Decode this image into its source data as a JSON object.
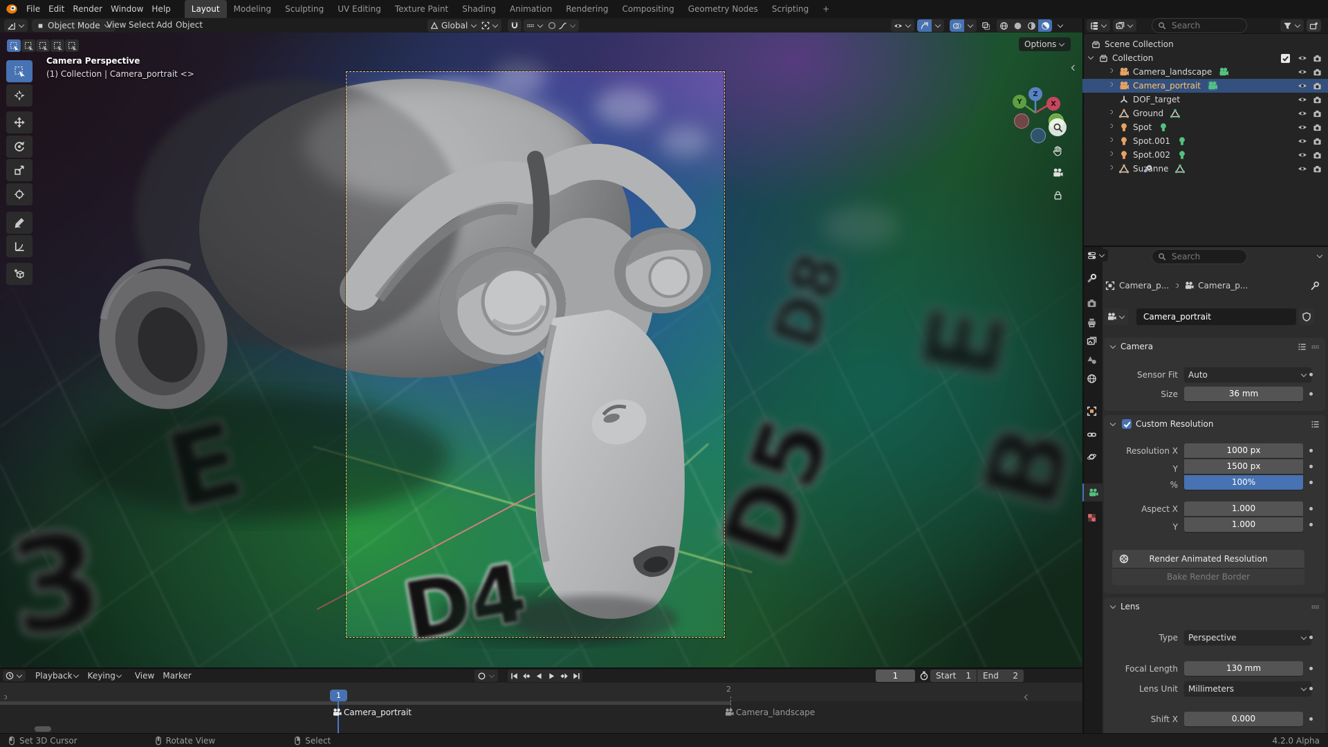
{
  "topbar": {
    "menus": [
      "File",
      "Edit",
      "Render",
      "Window",
      "Help"
    ],
    "workspaces": [
      "Layout",
      "Modeling",
      "Sculpting",
      "UV Editing",
      "Texture Paint",
      "Shading",
      "Animation",
      "Rendering",
      "Compositing",
      "Geometry Nodes",
      "Scripting"
    ],
    "active_workspace": "Layout",
    "new_workspace": "+"
  },
  "viewport_header": {
    "mode": "Object Mode",
    "menus": [
      "View",
      "Select",
      "Add",
      "Object"
    ],
    "orientation": "Global",
    "options": "Options"
  },
  "viewport": {
    "overlay_title": "Camera Perspective",
    "overlay_subtitle": "(1) Collection | Camera_portrait <>",
    "gizmo": {
      "x": "X",
      "y": "Y",
      "z": "Z"
    },
    "board_letters": [
      "E",
      "3",
      "D4",
      "D5",
      "B",
      "E",
      "D8"
    ]
  },
  "outliner": {
    "search_placeholder": "Search",
    "scene_collection": "Scene Collection",
    "collection": "Collection",
    "items": [
      {
        "name": "Camera_landscape",
        "type": "camera"
      },
      {
        "name": "Camera_portrait",
        "type": "camera",
        "selected": true
      },
      {
        "name": "DOF_target",
        "type": "empty"
      },
      {
        "name": "Ground",
        "type": "mesh"
      },
      {
        "name": "Spot",
        "type": "light"
      },
      {
        "name": "Spot.001",
        "type": "light"
      },
      {
        "name": "Spot.002",
        "type": "light"
      },
      {
        "name": "Suzanne",
        "type": "mesh"
      }
    ]
  },
  "properties": {
    "search_placeholder": "Search",
    "breadcrumb": {
      "object": "Camera_p...",
      "data": "Camera_p..."
    },
    "name_field": "Camera_portrait",
    "camera_panel": {
      "title": "Camera",
      "sensor_fit_label": "Sensor Fit",
      "sensor_fit_value": "Auto",
      "size_label": "Size",
      "size_value": "36 mm"
    },
    "resolution_panel": {
      "title": "Custom Resolution",
      "rows": [
        {
          "label": "Resolution X",
          "value": "1000 px"
        },
        {
          "label": "Y",
          "value": "1500 px"
        },
        {
          "label": "%",
          "value": "100%"
        },
        {
          "label": "Aspect X",
          "value": "1.000"
        },
        {
          "label": "Y",
          "value": "1.000"
        }
      ],
      "button_primary": "Render Animated Resolution",
      "button_secondary": "Bake Render Border"
    },
    "lens_panel": {
      "title": "Lens",
      "type_label": "Type",
      "type_value": "Perspective",
      "focal_label": "Focal Length",
      "focal_value": "130 mm",
      "unit_label": "Lens Unit",
      "unit_value": "Millimeters",
      "shift_label": "Shift X",
      "shift_value": "0.000"
    }
  },
  "timeline": {
    "menus": [
      "Playback",
      "Keying",
      "View",
      "Marker"
    ],
    "current_frame": "1",
    "start_label": "Start",
    "start_value": "1",
    "end_label": "End",
    "end_value": "2",
    "tick_label": "2",
    "markers": [
      {
        "name": "Camera_portrait",
        "selected": true
      },
      {
        "name": "Camera_landscape",
        "selected": false
      }
    ]
  },
  "statusbar": {
    "hints": [
      "Set 3D Cursor",
      "Rotate View",
      "Select"
    ],
    "version": "4.2.0 Alpha"
  },
  "colors": {
    "accent": "#4772b3",
    "selection_row": "#33507e",
    "active_object_text": "#ffc46b",
    "object_icon": "#e6a163",
    "data_icon": "#53c27f"
  }
}
